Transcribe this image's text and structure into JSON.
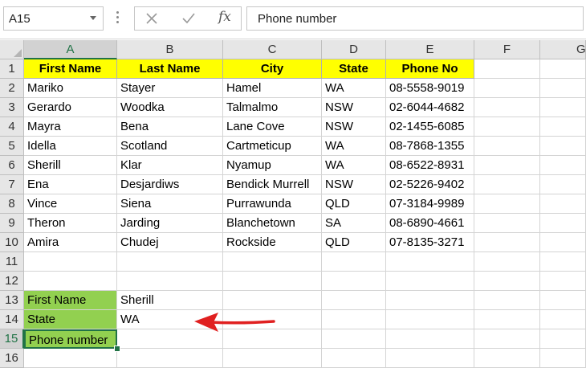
{
  "name_box": {
    "value": "A15"
  },
  "formula_bar": {
    "value": "Phone number",
    "fx_label": "fx"
  },
  "columns": [
    "A",
    "B",
    "C",
    "D",
    "E",
    "F",
    "G"
  ],
  "rows": [
    "1",
    "2",
    "3",
    "4",
    "5",
    "6",
    "7",
    "8",
    "9",
    "10",
    "11",
    "12",
    "13",
    "14",
    "15",
    "16"
  ],
  "table": {
    "headers": [
      "First Name",
      "Last Name",
      "City",
      "State",
      "Phone No"
    ],
    "records": [
      [
        "Mariko",
        "Stayer",
        "Hamel",
        "WA",
        "08-5558-9019"
      ],
      [
        "Gerardo",
        "Woodka",
        "Talmalmo",
        "NSW",
        "02-6044-4682"
      ],
      [
        "Mayra",
        "Bena",
        "Lane Cove",
        "NSW",
        "02-1455-6085"
      ],
      [
        "Idella",
        "Scotland",
        "Cartmeticup",
        "WA",
        "08-7868-1355"
      ],
      [
        "Sherill",
        "Klar",
        "Nyamup",
        "WA",
        "08-6522-8931"
      ],
      [
        "Ena",
        "Desjardiws",
        "Bendick Murrell",
        "NSW",
        "02-5226-9402"
      ],
      [
        "Vince",
        "Siena",
        "Purrawunda",
        "QLD",
        "07-3184-9989"
      ],
      [
        "Theron",
        "Jarding",
        "Blanchetown",
        "SA",
        "08-6890-4661"
      ],
      [
        "Amira",
        "Chudej",
        "Rockside",
        "QLD",
        "07-8135-3271"
      ]
    ]
  },
  "lookup": {
    "labels": [
      "First Name",
      "State",
      "Phone number"
    ],
    "values": [
      "Sherill",
      "WA",
      ""
    ]
  },
  "colors": {
    "header_fill": "#ffff00",
    "label_fill": "#92d050",
    "selection": "#217346",
    "arrow": "#e02020"
  }
}
